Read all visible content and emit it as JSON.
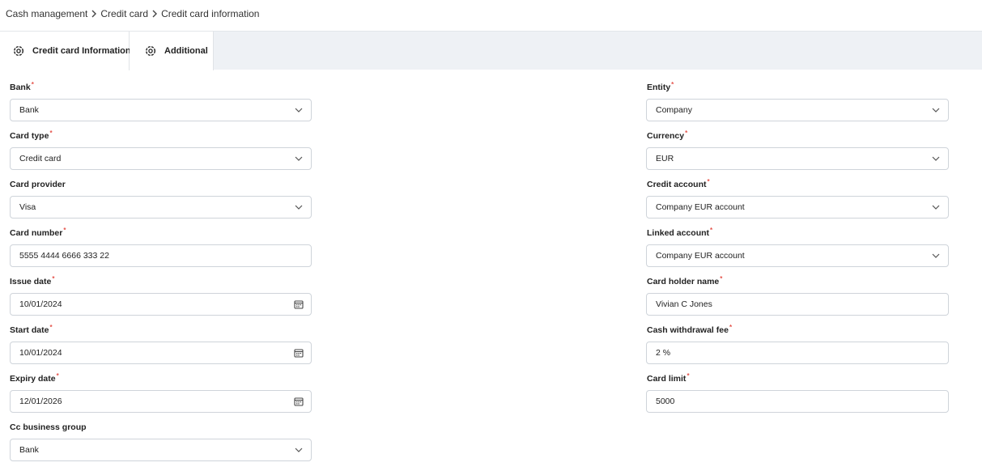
{
  "breadcrumb": [
    "Cash management",
    "Credit card",
    "Credit card information"
  ],
  "tabs": [
    {
      "label": "Credit card Information",
      "icon": "settings-icon",
      "active": true
    },
    {
      "label": "Additional",
      "icon": "settings-icon",
      "active": false
    }
  ],
  "required_marker": "*",
  "colors": {
    "required": "#e5534b",
    "tab_bar": "#eef1f5",
    "border": "#cfd4da"
  },
  "form": {
    "bank": {
      "label": "Bank",
      "value": "Bank"
    },
    "card_type": {
      "label": "Card type",
      "value": "Credit card"
    },
    "card_provider": {
      "label": "Card provider",
      "value": "Visa"
    },
    "card_number": {
      "label": "Card number",
      "value": "5555 4444 6666 333 22"
    },
    "issue_date": {
      "label": "Issue date",
      "value": "10/01/2024"
    },
    "start_date": {
      "label": "Start date",
      "value": "10/01/2024"
    },
    "expiry_date": {
      "label": "Expiry date",
      "value": "12/01/2026"
    },
    "cc_business_group": {
      "label": "Cc business group",
      "value": "Bank"
    },
    "entity": {
      "label": "Entity",
      "value": "Company"
    },
    "currency": {
      "label": "Currency",
      "value": "EUR"
    },
    "credit_account": {
      "label": "Credit account",
      "value": "Company EUR account"
    },
    "linked_account": {
      "label": "Linked account",
      "value": "Company EUR account"
    },
    "card_holder_name": {
      "label": "Card holder name",
      "value": "Vivian C Jones"
    },
    "cash_withdrawal_fee": {
      "label": "Cash withdrawal fee",
      "value": "2 %"
    },
    "card_limit": {
      "label": "Card limit",
      "value": "5000"
    }
  }
}
